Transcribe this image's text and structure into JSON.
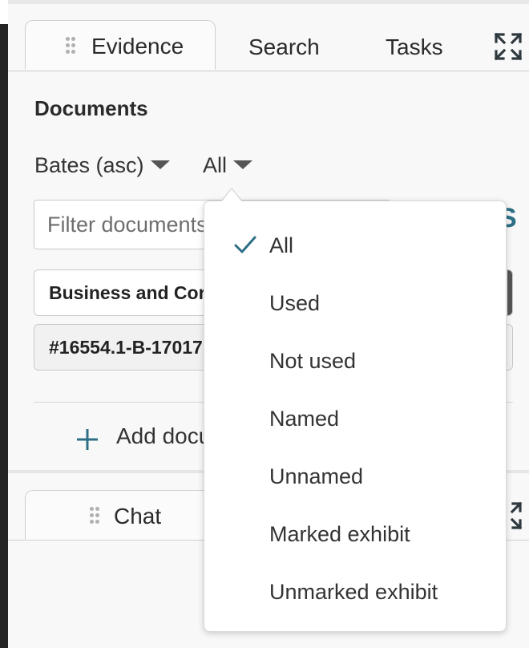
{
  "colors": {
    "accent": "#2d6f86",
    "panel_bg": "#f8f8f8",
    "dark_edge": "#242424"
  },
  "evidence_panel": {
    "tabs": [
      {
        "label": "Evidence",
        "active": true
      },
      {
        "label": "Search",
        "active": false
      },
      {
        "label": "Tasks",
        "active": false
      }
    ],
    "expand_icon": "expand-arrows-icon",
    "section_title": "Documents",
    "sort_label": "Bates (asc)",
    "filter_label": "All",
    "filter_placeholder": "Filter documents",
    "documents": [
      {
        "label": "Business and Corporate"
      },
      {
        "label": "#16554.1-B-17017"
      }
    ],
    "add_label": "Add documents"
  },
  "chat_panel": {
    "tab_label": "Chat"
  },
  "filter_menu": {
    "selected": "All",
    "options": [
      "All",
      "Used",
      "Not used",
      "Named",
      "Unnamed",
      "Marked exhibit",
      "Unmarked exhibit"
    ]
  }
}
